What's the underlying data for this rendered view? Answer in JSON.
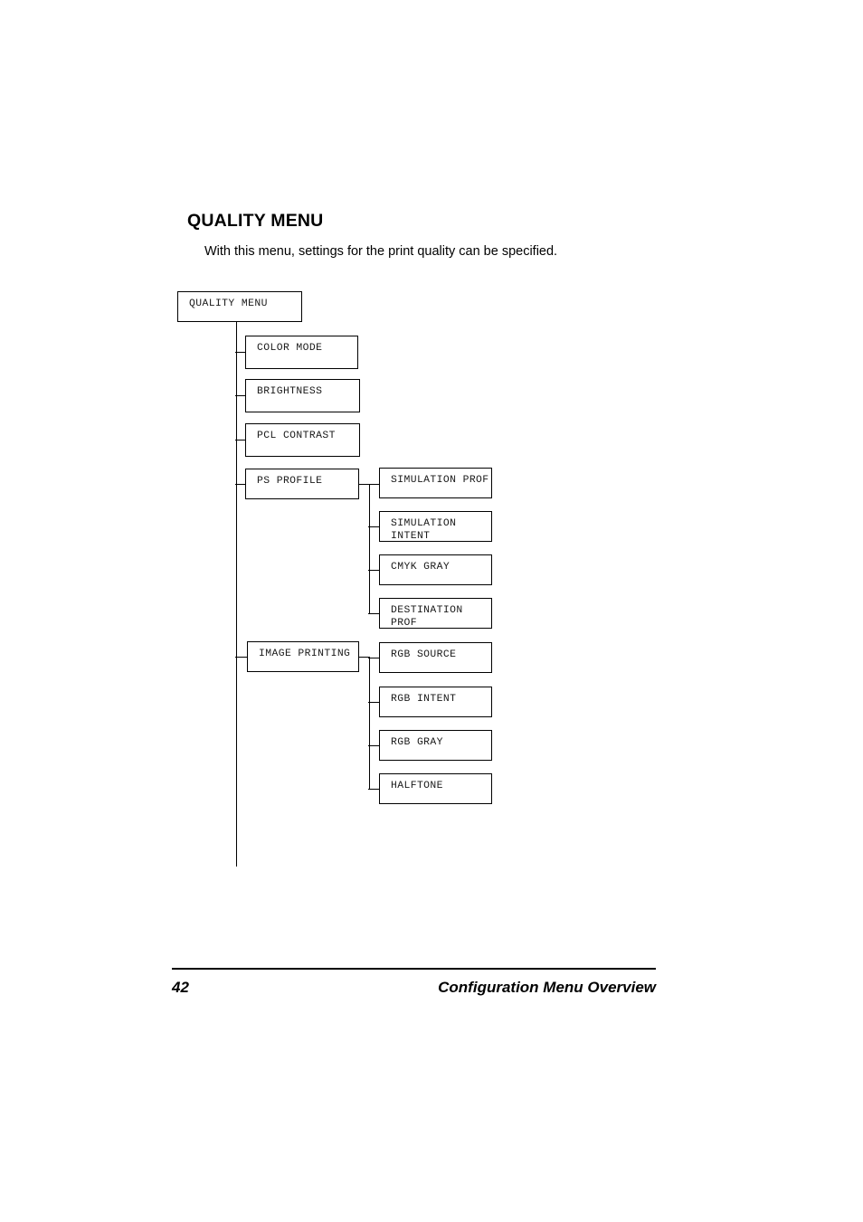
{
  "page": {
    "heading": "QUALITY MENU",
    "intro": "With this menu, settings for the print quality can be specified.",
    "footer": {
      "page_number": "42",
      "section_title": "Configuration Menu Overview"
    }
  },
  "diagram": {
    "root": {
      "label": "QUALITY MENU"
    },
    "level1": [
      {
        "label": "COLOR MODE"
      },
      {
        "label": "BRIGHTNESS"
      },
      {
        "label": "PCL CONTRAST"
      },
      {
        "label": "PS PROFILE"
      },
      {
        "label": "IMAGE PRINTING"
      }
    ],
    "ps_profile_children": [
      {
        "label": "SIMULATION PROF"
      },
      {
        "label": "SIMULATION\nINTENT"
      },
      {
        "label": "CMYK GRAY"
      },
      {
        "label": "DESTINATION\nPROF"
      }
    ],
    "image_printing_children": [
      {
        "label": "RGB SOURCE"
      },
      {
        "label": "RGB INTENT"
      },
      {
        "label": "RGB GRAY"
      },
      {
        "label": "HALFTONE"
      }
    ]
  }
}
